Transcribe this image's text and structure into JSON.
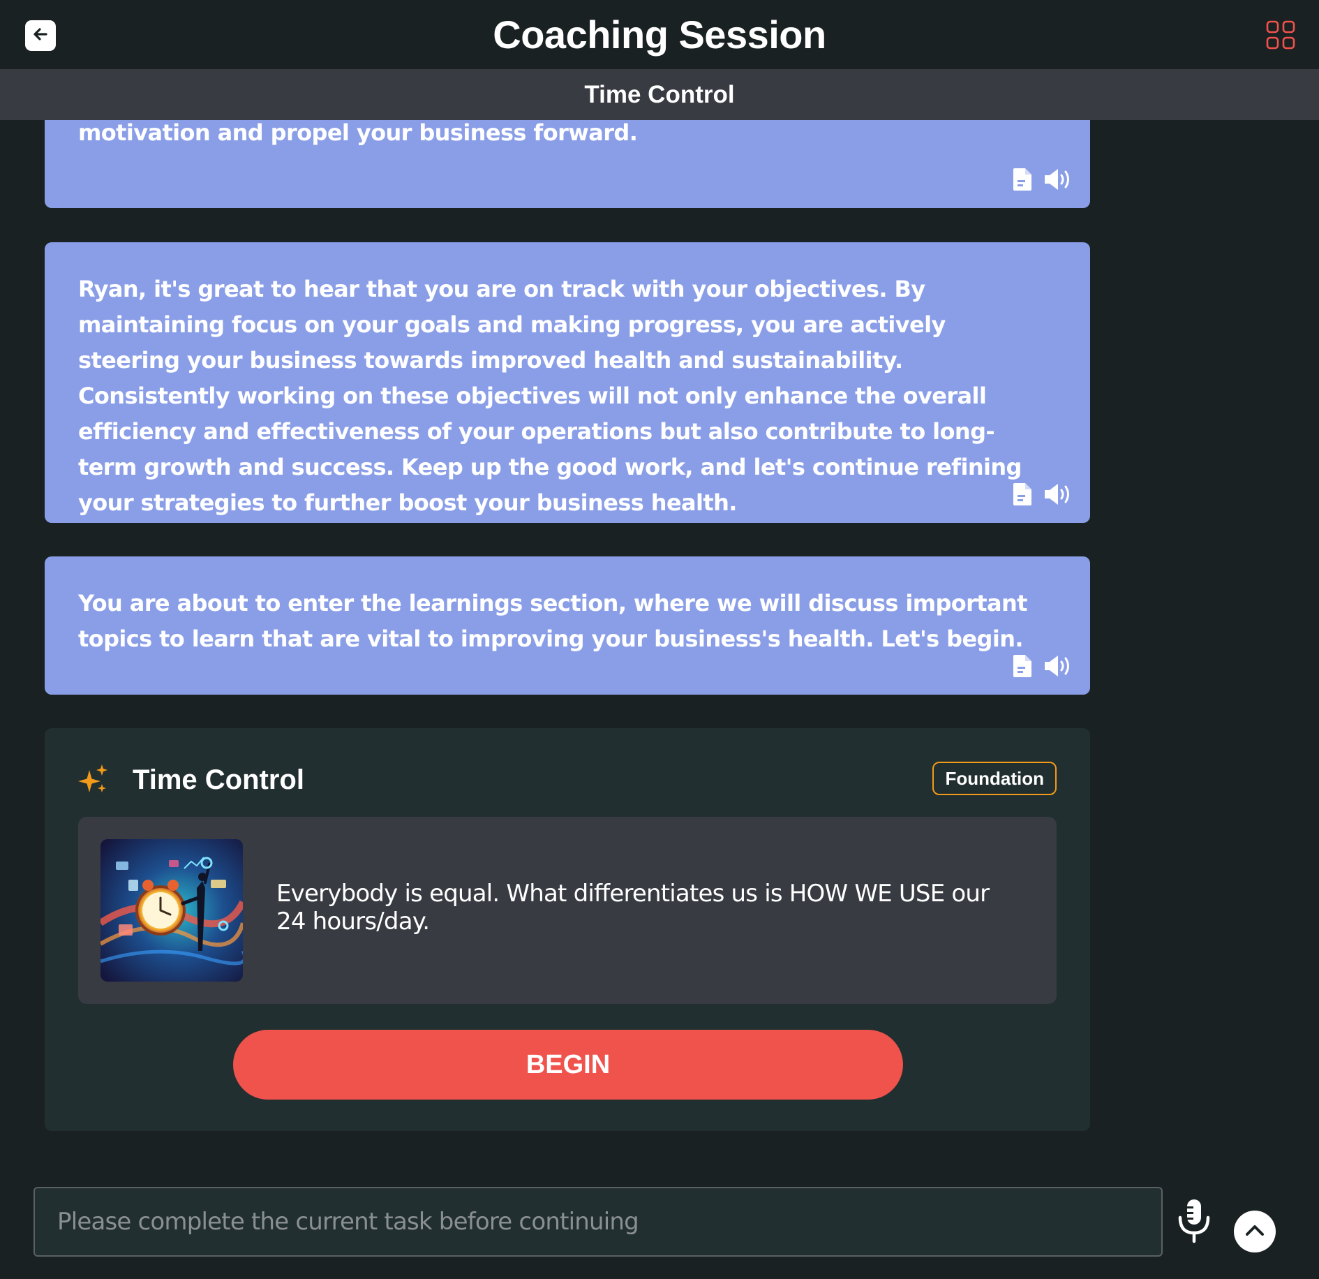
{
  "header": {
    "title": "Coaching Session",
    "back_icon": "arrow-left-icon",
    "menu_icon": "grid-icon",
    "accent_color": "#f0524c"
  },
  "subheader": {
    "title": "Time Control"
  },
  "messages": [
    {
      "text": "to business success. Let's explore strategies together to revitalize your motivation and propel your business forward.",
      "actions": [
        "document-icon",
        "speaker-icon"
      ]
    },
    {
      "text": "Ryan, it's great to hear that you are on track with your objectives. By maintaining focus on your goals and making progress, you are actively steering your business towards improved health and sustainability. Consistently working on these objectives will not only enhance the overall efficiency and effectiveness of your operations but also contribute to long-term growth and success. Keep up the good work, and let's continue refining your strategies to further boost your business health.",
      "actions": [
        "document-icon",
        "speaker-icon"
      ]
    },
    {
      "text": "You are about to enter the learnings section, where we will discuss important topics to learn that are vital to improving your business's health. Let's begin.",
      "actions": [
        "document-icon",
        "speaker-icon"
      ]
    }
  ],
  "learning_card": {
    "icon": "sparkle-icon",
    "title": "Time Control",
    "badge": "Foundation",
    "image_icon": "clock-illustration",
    "description": "Everybody is equal.  What differentiates us is HOW WE USE our 24 hours/day.",
    "button_label": "BEGIN"
  },
  "composer": {
    "placeholder": "Please complete the current task before continuing",
    "value": "",
    "mic_icon": "microphone-icon",
    "up_icon": "chevron-up-icon"
  },
  "colors": {
    "background": "#1a2122",
    "bubble": "#8a9ee8",
    "card": "#222f30",
    "panel": "#383b42",
    "badge_border": "#f29a1a",
    "button": "#f0524c"
  }
}
